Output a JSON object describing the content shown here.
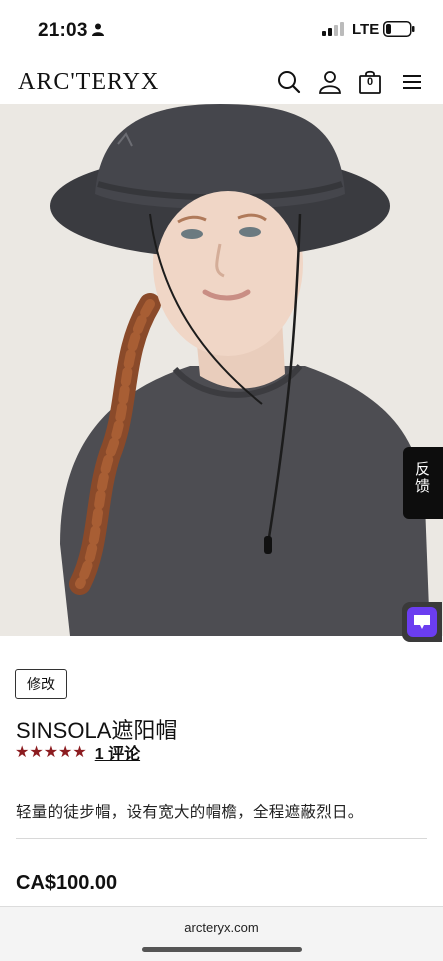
{
  "status_bar": {
    "time": "21:03",
    "network": "LTE",
    "icons": [
      "person-icon",
      "signal-icon",
      "battery-icon"
    ]
  },
  "header": {
    "brand": "ARC'TERYX",
    "cart_count": "0",
    "icons": [
      "search-icon",
      "account-icon",
      "cart-icon",
      "menu-icon"
    ]
  },
  "hero": {
    "description": "product-photo-hat",
    "feedback_label": "反馈"
  },
  "product": {
    "edit_label": "修改",
    "title": "SINSOLA遮阳帽",
    "rating_stars": 5,
    "stars_text": "★★★★★",
    "reviews_label": "1 评论",
    "description": "轻量的徒步帽，设有宽大的帽檐，全程遮蔽烈日。",
    "price": "CA$100.00"
  },
  "browser": {
    "url": "arcteryx.com"
  },
  "colors": {
    "star": "#8c1c20",
    "chat_button": "#6b3df0",
    "feedback_tab": "#0d0d0d"
  }
}
